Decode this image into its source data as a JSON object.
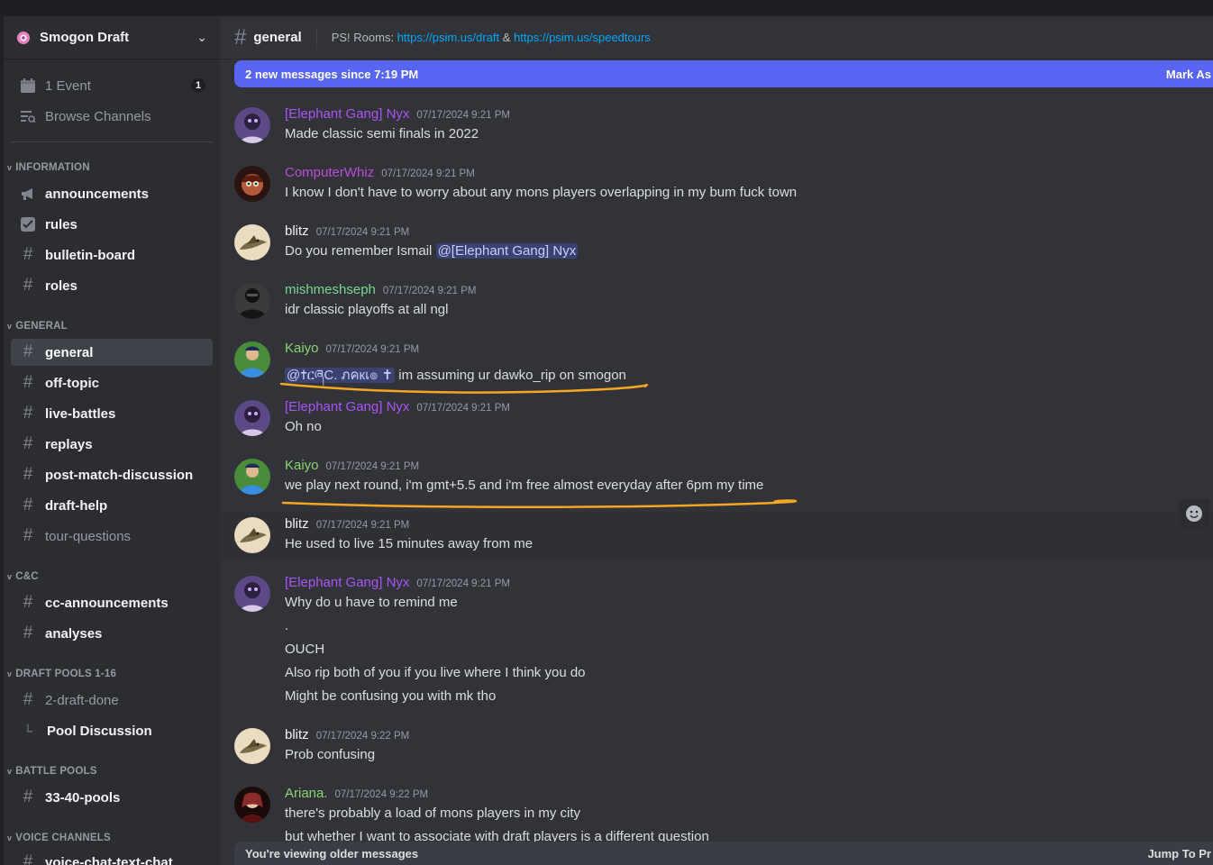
{
  "server": {
    "name": "Smogon Draft"
  },
  "sidebar": {
    "top_items": [
      {
        "label": "1 Event",
        "icon": "calendar-icon",
        "badge": "1"
      },
      {
        "label": "Browse Channels",
        "icon": "browse-channels-icon"
      }
    ],
    "categories": [
      {
        "name": "INFORMATION"
      },
      {
        "name": "GENERAL"
      },
      {
        "name": "C&C"
      },
      {
        "name": "DRAFT POOLS 1-16"
      },
      {
        "name": "BATTLE POOLS"
      },
      {
        "name": "VOICE CHANNELS"
      }
    ],
    "channels": [
      {
        "label": "announcements",
        "icon": "megaphone-icon"
      },
      {
        "label": "rules",
        "icon": "checkbox-icon"
      },
      {
        "label": "bulletin-board",
        "icon": "hash-icon"
      },
      {
        "label": "roles",
        "icon": "hash-icon"
      },
      {
        "label": "general",
        "icon": "hash-icon"
      },
      {
        "label": "off-topic",
        "icon": "hash-icon"
      },
      {
        "label": "live-battles",
        "icon": "hash-icon"
      },
      {
        "label": "replays",
        "icon": "hash-icon"
      },
      {
        "label": "post-match-discussion",
        "icon": "hash-icon"
      },
      {
        "label": "draft-help",
        "icon": "hash-icon"
      },
      {
        "label": "tour-questions",
        "icon": "hash-icon"
      },
      {
        "label": "cc-announcements",
        "icon": "hash-icon"
      },
      {
        "label": "analyses",
        "icon": "hash-icon"
      },
      {
        "label": "2-draft-done",
        "icon": "hash-thread-icon"
      },
      {
        "label": "Pool Discussion",
        "icon": "thread-branch-icon"
      },
      {
        "label": "33-40-pools",
        "icon": "hash-thread-icon"
      },
      {
        "label": "voice-chat-text-chat",
        "icon": "hash-icon"
      }
    ]
  },
  "channel": {
    "name": "general",
    "topic_prefix": "PS! Rooms:",
    "link1": "https://psim.us/draft",
    "amp": "&",
    "link2": "https://psim.us/speedtours"
  },
  "new_messages_bar": {
    "text": "2 new messages since 7:19 PM",
    "action": "Mark As"
  },
  "messages": [
    {
      "user": "[Elephant Gang] Nyx",
      "color": "#a855f7",
      "time": "07/17/2024 9:21 PM",
      "lines": [
        "Made classic semi finals in 2022"
      ]
    },
    {
      "user": "ComputerWhiz",
      "color": "#b84fd6",
      "time": "07/17/2024 9:21 PM",
      "lines": [
        "I know I don't have to worry about any mons players overlapping in my bum fuck town"
      ]
    },
    {
      "user": "blitz",
      "color": "#f2f3f5",
      "time": "07/17/2024 9:21 PM",
      "line_prefix": "Do you remember Ismail ",
      "mention": "@[Elephant Gang] Nyx"
    },
    {
      "user": "mishmeshseph",
      "color": "#7bd88f",
      "time": "07/17/2024 9:21 PM",
      "lines": [
        "idr classic playoffs at all ngl"
      ]
    },
    {
      "user": "Kaiyo",
      "color": "#8bd470",
      "time": "07/17/2024 9:21 PM",
      "mention": "@✝ርཞC. ภคкเ๏ ✝",
      "line_suffix": " im assuming ur dawko_rip on smogon"
    },
    {
      "user": "[Elephant Gang] Nyx",
      "color": "#a855f7",
      "time": "07/17/2024 9:21 PM",
      "lines": [
        "Oh no"
      ]
    },
    {
      "user": "Kaiyo",
      "color": "#8bd470",
      "time": "07/17/2024 9:21 PM",
      "lines": [
        "we play next round, i'm gmt+5.5 and i'm free almost everyday after 6pm my time"
      ]
    },
    {
      "user": "blitz",
      "color": "#f2f3f5",
      "time": "07/17/2024 9:21 PM",
      "lines": [
        "He used to live 15 minutes away from me"
      ]
    },
    {
      "user": "[Elephant Gang] Nyx",
      "color": "#a855f7",
      "time": "07/17/2024 9:21 PM",
      "lines": [
        "Why do u have to remind me",
        ".",
        "OUCH",
        "Also rip both of you if you live where I think you do",
        "Might be confusing you with mk tho"
      ]
    },
    {
      "user": "blitz",
      "color": "#f2f3f5",
      "time": "07/17/2024 9:22 PM",
      "lines": [
        "Prob confusing"
      ]
    },
    {
      "user": "Ariana.",
      "color": "#8bd470",
      "time": "07/17/2024 9:22 PM",
      "lines": [
        "there's probably a load of mons players in my city",
        "but whether I want to associate with draft players is a different question"
      ]
    }
  ],
  "older_bar": {
    "text": "You're viewing older messages",
    "action": "Jump To Pr"
  },
  "colors": {
    "accent": "#5865f2",
    "underline": "#f5a623",
    "link": "#00a8fc"
  }
}
